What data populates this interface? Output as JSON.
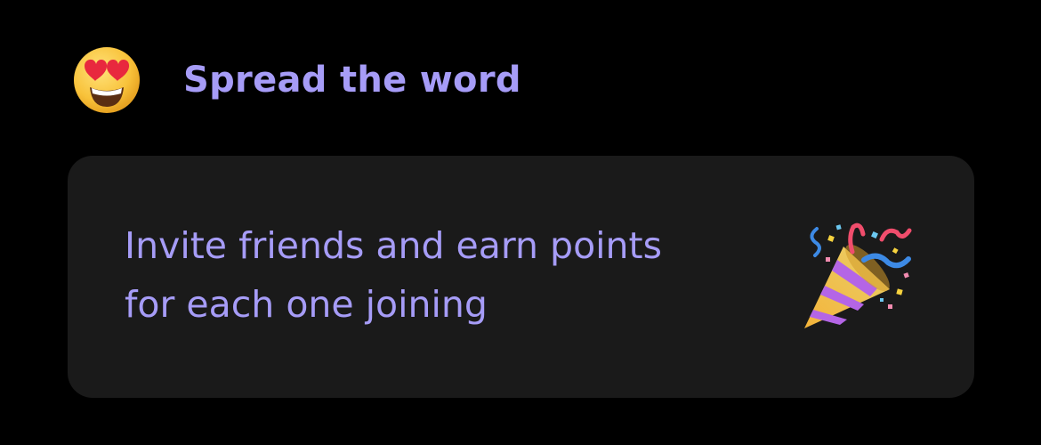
{
  "section": {
    "title": "Spread the word",
    "icon": "heart-eyes-emoji-icon"
  },
  "invite_card": {
    "line1": "Invite friends and earn points",
    "line2": "for each one joining",
    "icon": "party-popper-icon"
  },
  "colors": {
    "background": "#000000",
    "card_background": "#1A1A1A",
    "accent_text": "#A69CF7"
  }
}
